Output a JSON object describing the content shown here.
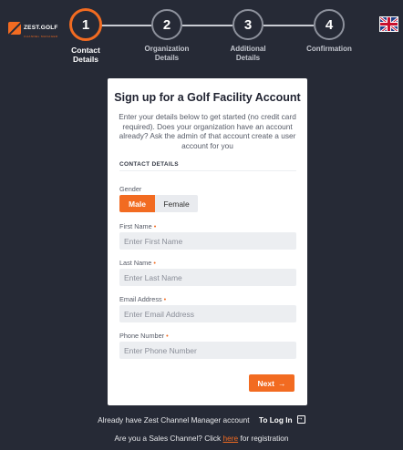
{
  "brand": {
    "name": "ZEST.GOLF",
    "tagline": "CHANNEL MANAGER",
    "accent": "#f26b21"
  },
  "steps": [
    {
      "number": "1",
      "label_line1": "Contact",
      "label_line2": "Details",
      "active": true
    },
    {
      "number": "2",
      "label_line1": "Organization",
      "label_line2": "Details",
      "active": false
    },
    {
      "number": "3",
      "label_line1": "Additional",
      "label_line2": "Details",
      "active": false
    },
    {
      "number": "4",
      "label_line1": "Confirmation",
      "label_line2": "",
      "active": false
    }
  ],
  "language_icon": "uk-flag-icon",
  "card": {
    "title": "Sign up for a Golf Facility Account",
    "description": "Enter your details below to get started (no credit card required). Does your organization have an account already? Ask the admin of that account create a user account for you",
    "section_title": "CONTACT DETAILS",
    "gender": {
      "label": "Gender",
      "options": [
        "Male",
        "Female"
      ],
      "selected": "Male"
    },
    "fields": {
      "first_name": {
        "label": "First Name",
        "required_mark": "•",
        "placeholder": "Enter First Name",
        "value": ""
      },
      "last_name": {
        "label": "Last Name",
        "required_mark": "•",
        "placeholder": "Enter Last Name",
        "value": ""
      },
      "email": {
        "label": "Email Address",
        "required_mark": "•",
        "placeholder": "Enter Email Address",
        "value": ""
      },
      "phone": {
        "label": "Phone Number",
        "required_mark": "•",
        "placeholder": "Enter Phone Number",
        "value": ""
      }
    },
    "next_label": "Next",
    "next_icon": "arrow-right-icon"
  },
  "footer": {
    "login_prompt": "Already have Zest Channel Manager account",
    "login_label": "To Log In",
    "login_icon": "login-icon",
    "sales_prefix": "Are you a Sales Channel? Click",
    "sales_link": "here",
    "sales_suffix": "for registration"
  }
}
